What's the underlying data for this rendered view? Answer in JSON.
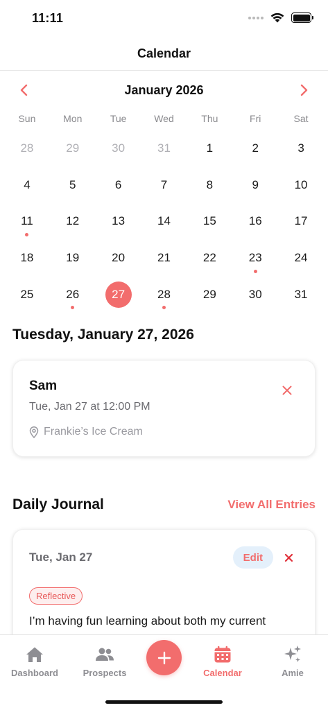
{
  "status_bar": {
    "time": "11:11"
  },
  "header": {
    "title": "Calendar"
  },
  "calendar": {
    "month_label": "January 2026",
    "weekdays": [
      "Sun",
      "Mon",
      "Tue",
      "Wed",
      "Thu",
      "Fri",
      "Sat"
    ],
    "days": [
      {
        "label": "28",
        "muted": true
      },
      {
        "label": "29",
        "muted": true
      },
      {
        "label": "30",
        "muted": true
      },
      {
        "label": "31",
        "muted": true
      },
      {
        "label": "1"
      },
      {
        "label": "2"
      },
      {
        "label": "3"
      },
      {
        "label": "4"
      },
      {
        "label": "5"
      },
      {
        "label": "6"
      },
      {
        "label": "7"
      },
      {
        "label": "8"
      },
      {
        "label": "9"
      },
      {
        "label": "10"
      },
      {
        "label": "11",
        "event": true
      },
      {
        "label": "12"
      },
      {
        "label": "13"
      },
      {
        "label": "14"
      },
      {
        "label": "15"
      },
      {
        "label": "16"
      },
      {
        "label": "17"
      },
      {
        "label": "18"
      },
      {
        "label": "19"
      },
      {
        "label": "20"
      },
      {
        "label": "21"
      },
      {
        "label": "22"
      },
      {
        "label": "23",
        "event": true
      },
      {
        "label": "24"
      },
      {
        "label": "25"
      },
      {
        "label": "26",
        "event": true
      },
      {
        "label": "27",
        "selected": true
      },
      {
        "label": "28",
        "event": true
      },
      {
        "label": "29"
      },
      {
        "label": "30"
      },
      {
        "label": "31"
      }
    ],
    "accent_color": "#f26d6d"
  },
  "selected_date_heading": "Tuesday, January 27, 2026",
  "event": {
    "name": "Sam",
    "when": "Tue, Jan 27 at 12:00 PM",
    "place": "Frankie’s Ice Cream"
  },
  "journal": {
    "section_title": "Daily Journal",
    "view_all_label": "View All Entries",
    "entry_date": "Tue, Jan 27",
    "edit_label": "Edit",
    "mood": "Reflective",
    "text": "I’m having fun learning about both my current"
  },
  "tab_bar": {
    "tabs": [
      {
        "label": "Dashboard",
        "icon": "home-icon"
      },
      {
        "label": "Prospects",
        "icon": "people-icon"
      },
      {
        "label": "Calendar",
        "icon": "calendar-icon",
        "active": true
      },
      {
        "label": "Amie",
        "icon": "sparkles-icon"
      }
    ],
    "add_icon": "plus-icon"
  }
}
